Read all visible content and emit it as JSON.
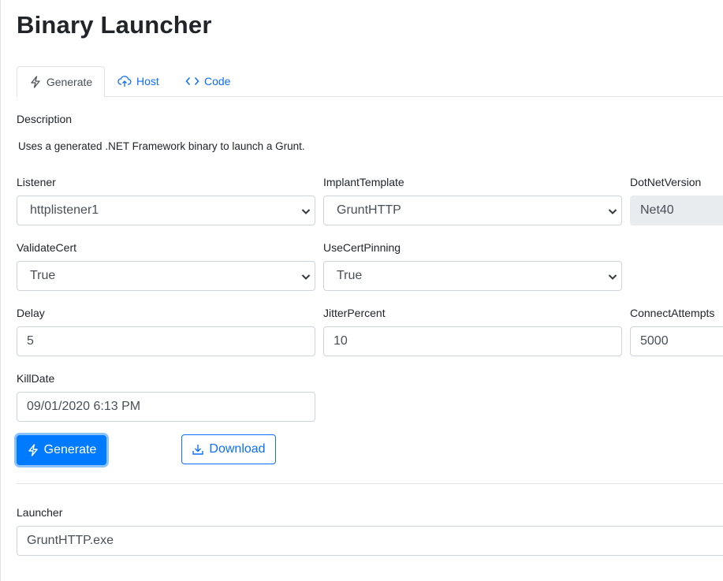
{
  "page": {
    "title": "Binary Launcher"
  },
  "tabs": [
    {
      "label": "Generate",
      "icon": "lightning-icon",
      "active": true
    },
    {
      "label": "Host",
      "icon": "cloud-upload-icon",
      "active": false
    },
    {
      "label": "Code",
      "icon": "code-icon",
      "active": false
    }
  ],
  "description": {
    "label": "Description",
    "text": "Uses a generated .NET Framework binary to launch a Grunt."
  },
  "form": {
    "listener": {
      "label": "Listener",
      "value": "httplistener1"
    },
    "implant_template": {
      "label": "ImplantTemplate",
      "value": "GruntHTTP"
    },
    "dotnet_version": {
      "label": "DotNetVersion",
      "value": "Net40"
    },
    "validate_cert": {
      "label": "ValidateCert",
      "value": "True"
    },
    "use_cert_pinning": {
      "label": "UseCertPinning",
      "value": "True"
    },
    "delay": {
      "label": "Delay",
      "value": "5"
    },
    "jitter_percent": {
      "label": "JitterPercent",
      "value": "10"
    },
    "connect_attempts": {
      "label": "ConnectAttempts",
      "value": "5000"
    },
    "kill_date": {
      "label": "KillDate",
      "value": "09/01/2020 6:13 PM"
    }
  },
  "buttons": {
    "generate_label": "Generate",
    "download_label": "Download"
  },
  "launcher": {
    "label": "Launcher",
    "value": "GruntHTTP.exe"
  },
  "colors": {
    "primary": "#007bff",
    "link": "#0d6efd",
    "border": "#ced4da"
  }
}
